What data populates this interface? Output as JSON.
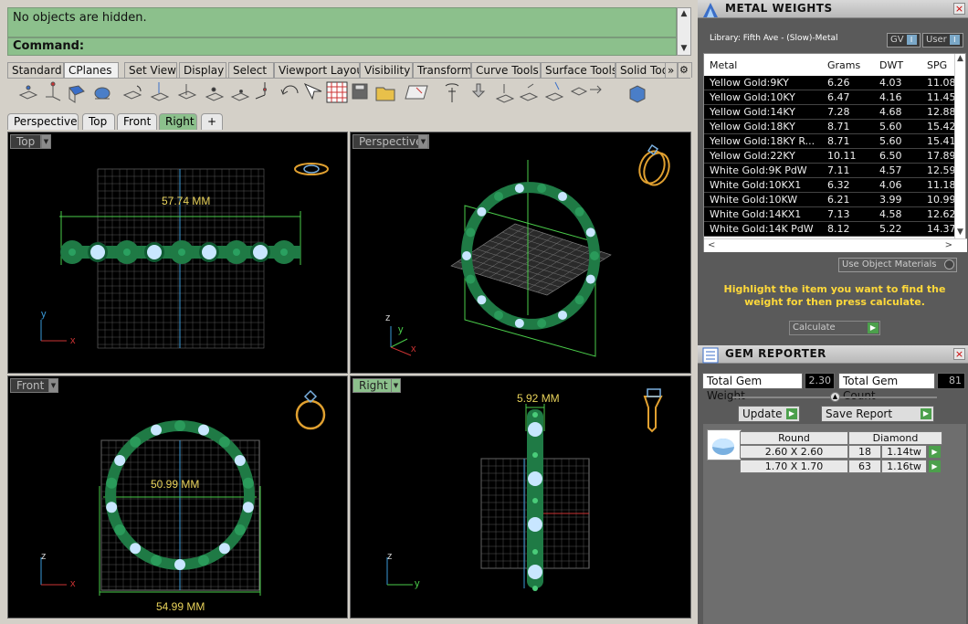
{
  "command": {
    "history_text": "No objects are hidden.",
    "prompt_label": "Command:"
  },
  "toolbar_tabs": [
    "Standard",
    "CPlanes",
    "Set View",
    "Display",
    "Select",
    "Viewport Layout",
    "Visibility",
    "Transform",
    "Curve Tools",
    "Surface Tools",
    "Solid Too"
  ],
  "toolbar_tabs_overflow": "»",
  "viewport_tabs": [
    "Perspective",
    "Top",
    "Front",
    "Right"
  ],
  "viewport_tab_add": "+",
  "viewports": {
    "top": {
      "label": "Top",
      "dimension": "57.74 MM",
      "axis_y": "y",
      "axis_x": "x"
    },
    "perspective": {
      "label": "Perspective",
      "axis_z": "z",
      "axis_y": "y",
      "axis_x": "x"
    },
    "front": {
      "label": "Front",
      "dimension_inner": "50.99 MM",
      "dimension_outer": "54.99 MM",
      "axis_z": "z",
      "axis_x": "x"
    },
    "right": {
      "label": "Right",
      "dimension": "5.92 MM",
      "axis_z": "z",
      "axis_y": "y"
    }
  },
  "metal_weights": {
    "title": "METAL WEIGHTS",
    "library_label": "Library: Fifth Ave - (Slow)-Metal",
    "gv_label": "GV",
    "user_label": "User",
    "columns": [
      "Metal",
      "Grams",
      "DWT",
      "SPG"
    ],
    "rows": [
      [
        "Yellow Gold:9KY",
        "6.26",
        "4.03",
        "11.08"
      ],
      [
        "Yellow Gold:10KY",
        "6.47",
        "4.16",
        "11.45"
      ],
      [
        "Yellow Gold:14KY",
        "7.28",
        "4.68",
        "12.88"
      ],
      [
        "Yellow Gold:18KY",
        "8.71",
        "5.60",
        "15.42"
      ],
      [
        "Yellow Gold:18KY R...",
        "8.71",
        "5.60",
        "15.41"
      ],
      [
        "Yellow Gold:22KY",
        "10.11",
        "6.50",
        "17.89"
      ],
      [
        "White Gold:9K PdW",
        "7.11",
        "4.57",
        "12.59"
      ],
      [
        "White Gold:10KX1",
        "6.32",
        "4.06",
        "11.18"
      ],
      [
        "White Gold:10KW",
        "6.21",
        "3.99",
        "10.99"
      ],
      [
        "White Gold:14KX1",
        "7.13",
        "4.58",
        "12.62"
      ],
      [
        "White Gold:14K PdW",
        "8.12",
        "5.22",
        "14.37"
      ]
    ],
    "use_object_materials": "Use Object Materials",
    "instruction": "Highlight the item you want to find the weight for then press calculate.",
    "calculate_label": "Calculate"
  },
  "gem_reporter": {
    "title": "GEM REPORTER",
    "total_weight_label": "Total Gem Weight",
    "total_weight_value": "2.30",
    "total_count_label": "Total Gem Count",
    "total_count_value": "81",
    "update_label": "Update",
    "save_report_label": "Save Report",
    "shape": "Round",
    "material": "Diamond",
    "gems": [
      {
        "size": "2.60 X 2.60",
        "count": "18",
        "weight": "1.14tw"
      },
      {
        "size": "1.70 X 1.70",
        "count": "63",
        "weight": "1.16tw"
      }
    ]
  },
  "colors": {
    "accent_green": "#8cc08c",
    "model_green": "#1f7a45",
    "gem_blue": "#c8e6ff",
    "highlight_yellow": "#ffd93a",
    "dim_yellow": "#e8d25a"
  }
}
